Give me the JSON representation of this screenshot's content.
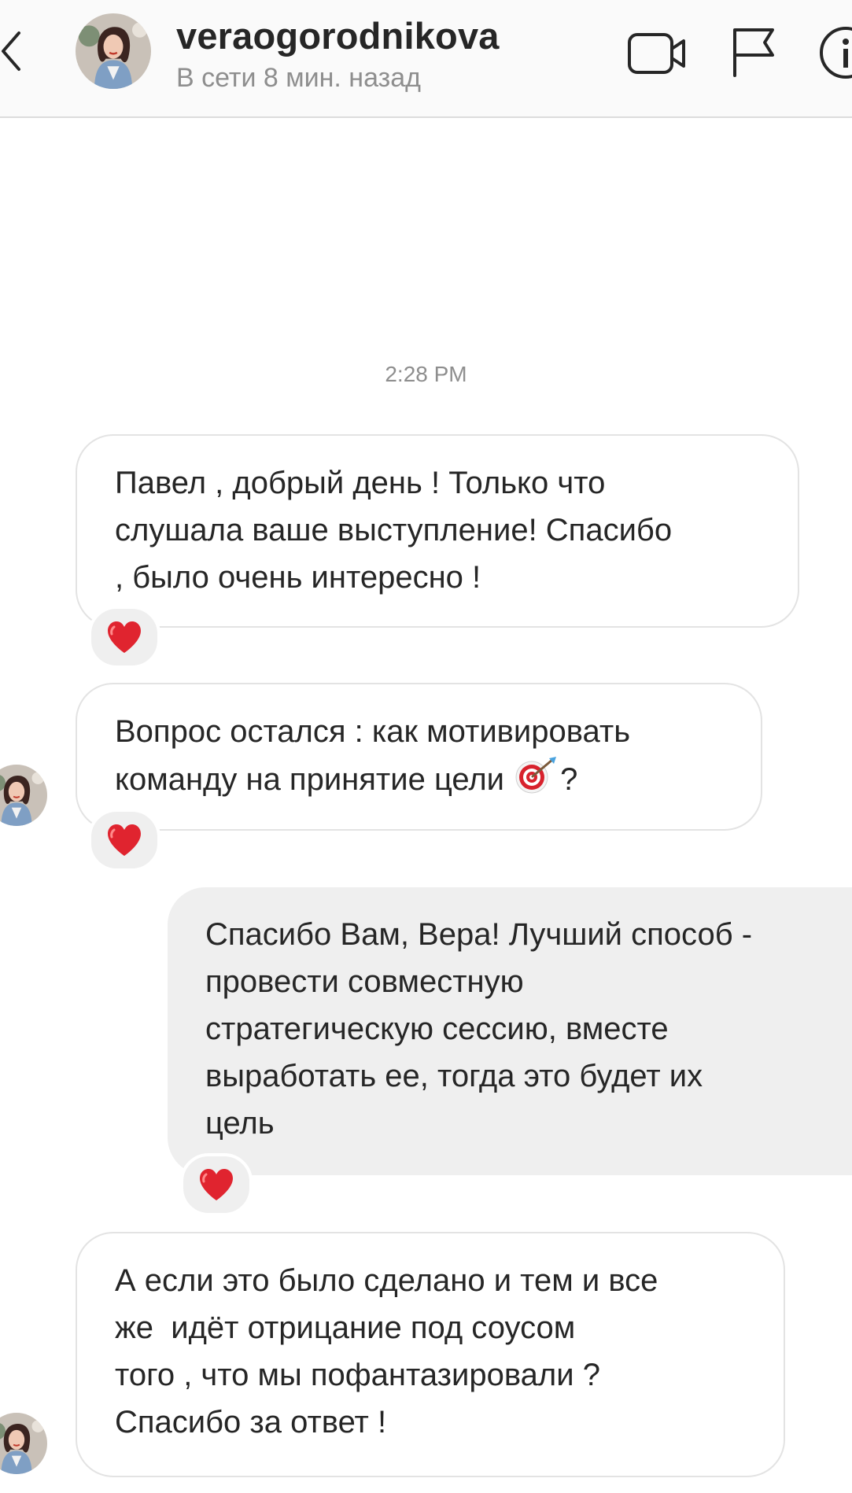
{
  "header": {
    "username": "veraogorodnikova",
    "status": "В сети 8 мин. назад"
  },
  "icons": {
    "back": "chevron-left-icon",
    "video": "video-camera-icon",
    "flag": "flag-icon",
    "info": "info-icon",
    "reaction": "red-heart-icon",
    "emoji": "direct-hit-target-icon"
  },
  "colors": {
    "heart": "#e0242f",
    "outgoing_bubble": "#efefef",
    "incoming_border": "#e3e3e3",
    "muted_text": "#8e8e8e"
  },
  "thread": {
    "timestamp": "2:28 PM",
    "messages": [
      {
        "direction": "incoming",
        "lines": [
          "Павел , добрый день ! Только что",
          "слушала ваше выступление! Спасибо",
          ", было очень интересно !"
        ],
        "reaction": "❤️"
      },
      {
        "direction": "incoming",
        "lines": [
          "Вопрос остался : как мотивировать",
          "команду на принятие цели ",
          "?"
        ],
        "reaction": "❤️"
      },
      {
        "direction": "outgoing",
        "lines": [
          "Спасибо Вам, Вера! Лучший способ -",
          "провести совместную",
          "стратегическую сессию, вместе",
          "выработать ее, тогда это будет их",
          "цель"
        ],
        "reaction": "❤️"
      },
      {
        "direction": "incoming",
        "lines": [
          "А если это было сделано и тем и все",
          "же  идёт отрицание под соусом",
          "того , что мы пофантазировали ?",
          "Спасибо за ответ !"
        ],
        "reaction": null
      }
    ]
  }
}
